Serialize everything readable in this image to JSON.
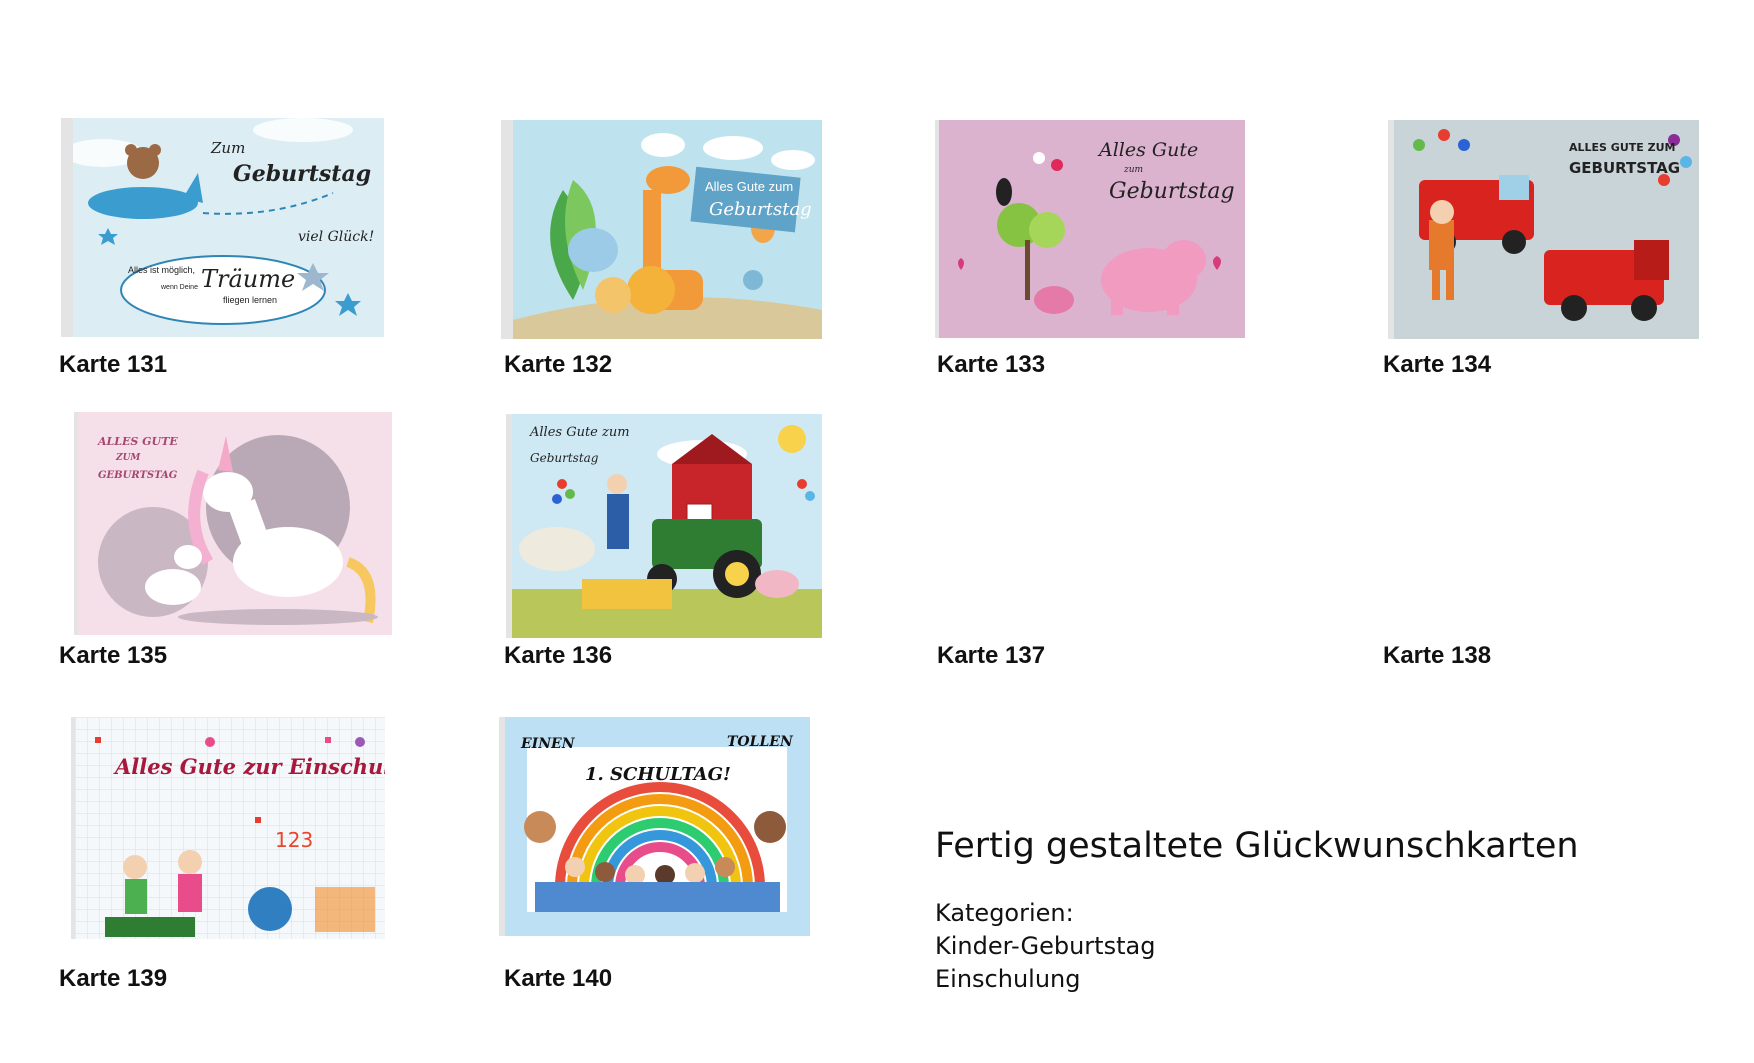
{
  "captions": {
    "c131": "Karte 131",
    "c132": "Karte 132",
    "c133": "Karte 133",
    "c134": "Karte 134",
    "c135": "Karte 135",
    "c136": "Karte 136",
    "c137": "Karte 137",
    "c138": "Karte 138",
    "c139": "Karte 139",
    "c140": "Karte 140"
  },
  "cards": {
    "k131": {
      "line1": "Zum",
      "line2": "Geburtstag",
      "line3": "viel Glück!",
      "small1": "Alles ist möglich,",
      "small2": "wenn Deine",
      "big": "Träume",
      "small3": "fliegen lernen"
    },
    "k132": {
      "line1": "Alles Gute zum",
      "line2": "Geburtstag"
    },
    "k133": {
      "line1": "Alles Gute",
      "line2": "zum",
      "line3": "Geburtstag"
    },
    "k134": {
      "line1": "Alles Gute zum",
      "line2": "Geburtstag"
    },
    "k135": {
      "line1": "Alles Gute",
      "line2": "zum",
      "line3": "Geburtstag"
    },
    "k136": {
      "line1": "Alles Gute zum",
      "line2": "Geburtstag"
    },
    "k139": {
      "line1": "Alles Gute zur Einschulung",
      "numbers": "123"
    },
    "k140": {
      "line1": "Einen",
      "line2": "tollen",
      "line3": "1. Schultag!"
    }
  },
  "info": {
    "title": "Fertig gestaltete Glückwunschkarten",
    "categories_label": "Kategorien:",
    "categories": [
      "Kinder-Geburtstag",
      "Einschulung"
    ]
  },
  "colors": {
    "k131_bg": "#dceef4",
    "k132_bg": "#bfe3ee",
    "k133_bg": "#dcb3cf",
    "k134_bg": "#c9d4d8",
    "k135_bg": "#f5dfe8",
    "k136_sky": "#cfe9f4",
    "k139_bg": "#f4f8fb",
    "k140_frame": "#bde0f5"
  }
}
